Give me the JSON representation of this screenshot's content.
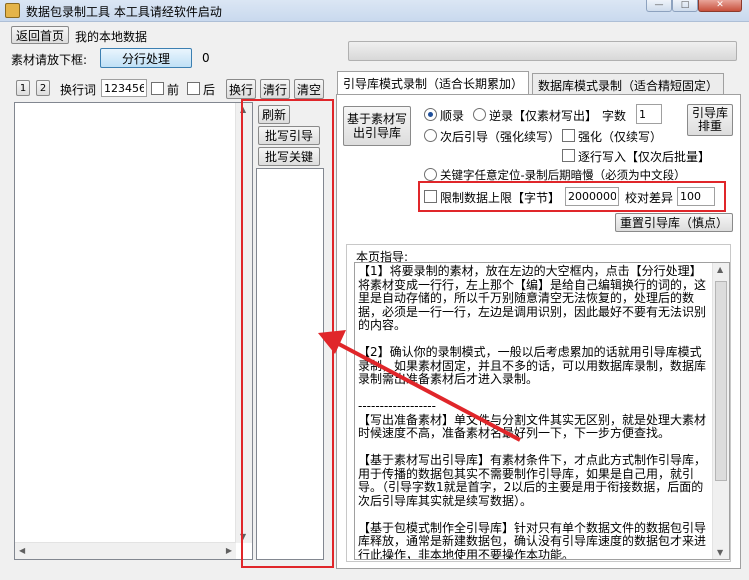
{
  "window": {
    "title": "数据包录制工具  本工具请经软件启动"
  },
  "toolbar": {
    "home_button": "返回首页",
    "local_data_label": "我的本地数据",
    "material_label": "素材请放下框:",
    "split_button": "分行处理",
    "split_count": "0"
  },
  "left_controls": {
    "btn_1": "1",
    "btn_2": "2",
    "newline_label": "换行词",
    "newline_value": "123456",
    "before_label": "前",
    "after_label": "后",
    "newline_button": "换行",
    "clean_button": "清行",
    "clear_button": "清空"
  },
  "mid_buttons": {
    "refresh": "刷新",
    "batch_write": "批写引导",
    "batch_key": "批写关键"
  },
  "tabs": [
    {
      "label": "引导库模式录制（适合长期累加）",
      "active": true
    },
    {
      "label": "数据库模式录制（适合精短固定）",
      "active": false
    }
  ],
  "guide_panel": {
    "write_from_material_button": "基于素材写\n出引导库",
    "order_label": "顺录",
    "reverse_label": "逆录【仅素材写出】",
    "char_count_label": "字数",
    "char_count_value": "1",
    "sort_button": "引导库\n排重",
    "after_guide_label": "次后引导（强化续写）",
    "strengthen_label": "强化（仅续写）",
    "stepwise_label": "逐行写入【仅次后批量】",
    "keyword_label": "关键字任意定位-录制后期暗慢（必须为中文段）",
    "limit_label": "限制数据上限【字节】",
    "limit_value": "2000000",
    "diff_label": "校对差异",
    "diff_value": "100",
    "reset_button": "重置引导库（慎点）"
  },
  "guide": {
    "title": "本页指导:",
    "text": "【1】将要录制的素材，放在左边的大空框内，点击【分行处理】将素材变成一行行，左上那个【编】是给自己编辑换行的词的，这里是自动存储的，所以千万别随意清空无法恢复的，处理后的数据，必须是一行一行，左边是调用识别，因此最好不要有无法识别的内容。\n\n【2】确认你的录制模式，一般以后考虑累加的话就用引导库模式录制，如果素材固定，并且不多的话，可以用数据库录制，数据库录制需出准备素材后才进入录制。\n\n------------------\n【写出准备素材】单文件与分割文件其实无区别，就是处理大素材时候速度不高，准备素材名最好列一下，下一步方便查找。\n\n【基于素材写出引导库】有素材条件下，才点此方式制作引导库，用于传播的数据包其实不需要制作引导库，如果是自己用，就引导。（引导字数1就是首字，2以后的主要是用于衔接数据，后面的次后引导库其实就是续写数据）。\n\n【基于包模式制作全引导库】针对只有单个数据文件的数据包引导库释放，通常是新建数据包，确认没有引导库速度的数据包才来进行此操作，非本地使用不要操作本功能。\n\n【引导库排重】就是指该数据包引导库内容有重复情况，则进行此"
  },
  "colors": {
    "highlight": "#e0262a",
    "blue_button": "#bfe0f6"
  }
}
